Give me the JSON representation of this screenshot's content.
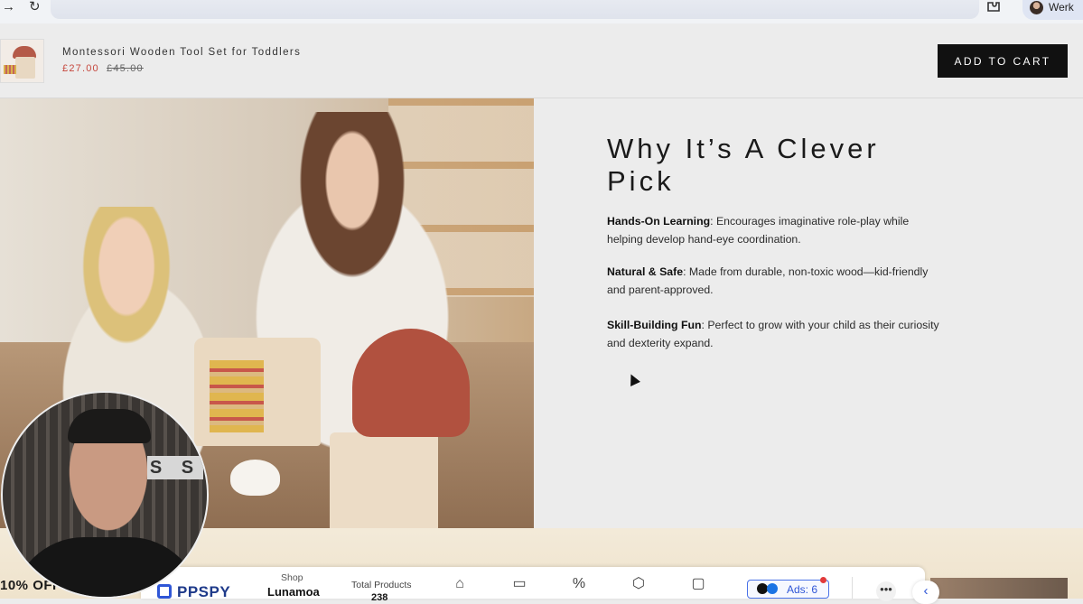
{
  "browser": {
    "profile_name": "Werk",
    "icons": [
      "forward-icon",
      "reload-icon",
      "extensions-icon"
    ]
  },
  "sticky_bar": {
    "product_title": "Montessori Wooden Tool Set for Toddlers",
    "price": "£27.00",
    "compare_price": "£45.00",
    "add_to_cart_label": "ADD TO CART"
  },
  "section": {
    "heading": "Why It’s A Clever Pick",
    "features": [
      {
        "title": "Hands-On Learning",
        "text": ": Encourages imaginative role-play while helping develop hand-eye coordination."
      },
      {
        "title": "Natural & Safe",
        "text": ": Made from durable, non-toxic wood—kid-friendly and parent-approved."
      },
      {
        "title": "Skill-Building Fun",
        "text": ": Perfect to grow with your child as their curiosity and dexterity expand."
      }
    ]
  },
  "discount_tab": {
    "label": "10% OFF"
  },
  "ppspy": {
    "logo": "PPSPY",
    "shop_label": "Shop",
    "shop_value": "Lunamoa",
    "total_products_label": "Total Products",
    "total_products_value": "238",
    "ads_label": "Ads: 6",
    "more_label": "•••",
    "nav_icons": [
      "home-icon",
      "store-icon",
      "discount-icon",
      "box-icon",
      "chat-icon"
    ]
  },
  "webcam_sign": "S S"
}
